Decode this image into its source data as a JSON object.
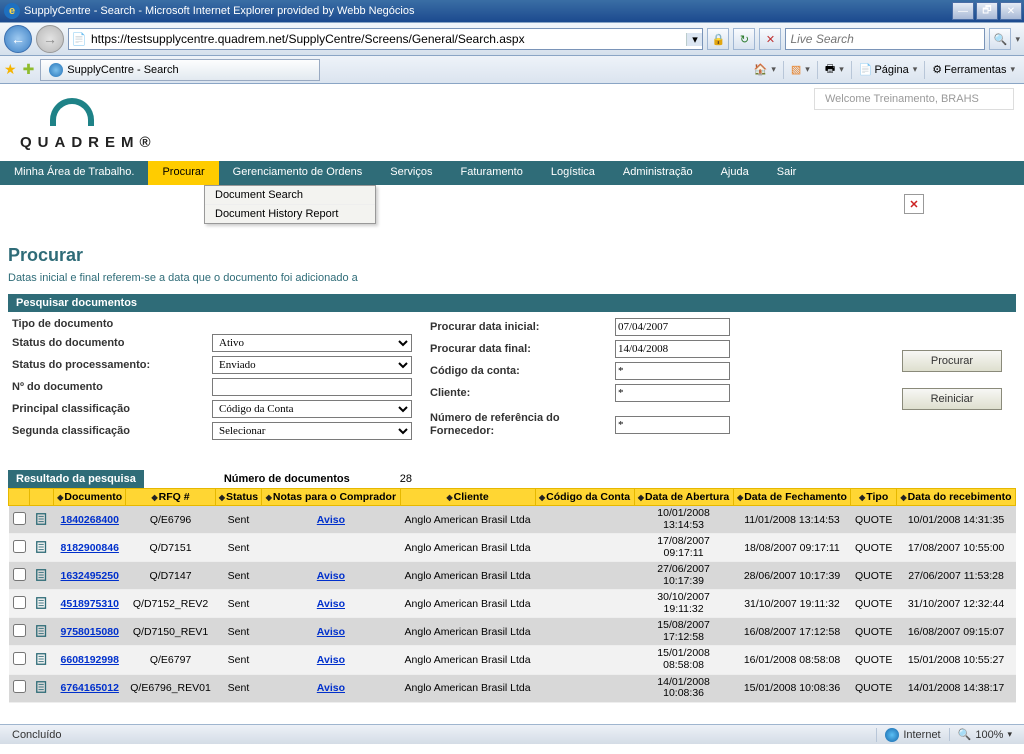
{
  "titlebar": {
    "text": "SupplyCentre - Search - Microsoft Internet Explorer provided by Webb Negócios"
  },
  "address": {
    "url": "https://testsupplycentre.quadrem.net/SupplyCentre/Screens/General/Search.aspx",
    "search_placeholder": "Live Search"
  },
  "tab": {
    "title": "SupplyCentre - Search"
  },
  "toolbar": {
    "pagina_label": "Página",
    "ferramentas_label": "Ferramentas"
  },
  "welcome": "Welcome  Treinamento, BRAHS",
  "logo_text": "QUADREM®",
  "menu": {
    "items": [
      "Minha Área de Trabalho.",
      "Procurar",
      "Gerenciamento de Ordens",
      "Serviços",
      "Faturamento",
      "Logística",
      "Administração",
      "Ajuda",
      "Sair"
    ],
    "active_index": 1,
    "submenu": [
      "Document Search",
      "Document History Report"
    ]
  },
  "page_title": "Procurar",
  "subtitle": "Datas inicial e final referem-se a data que o documento foi adicionado a",
  "panel_title": "Pesquisar documentos",
  "form": {
    "tipo_doc": "Tipo de documento",
    "status_doc": "Status do documento",
    "status_doc_val": "Ativo",
    "status_proc": "Status do processamento:",
    "status_proc_val": "Enviado",
    "no_doc": "Nº do documento",
    "no_doc_val": "",
    "princ_class": "Principal classificação",
    "princ_class_val": "Código da Conta",
    "seg_class": "Segunda classificação",
    "seg_class_val": "Selecionar",
    "data_inicial": "Procurar data inicial:",
    "data_inicial_val": "07/04/2007",
    "data_final": "Procurar data final:",
    "data_final_val": "14/04/2008",
    "cod_conta": "Código da conta:",
    "cod_conta_val": "*",
    "cliente": "Cliente:",
    "cliente_val": "*",
    "num_ref": "Número de referência do Fornecedor:",
    "num_ref_val": "*",
    "btn_procurar": "Procurar",
    "btn_reiniciar": "Reiniciar"
  },
  "results": {
    "title": "Resultado da pesquisa",
    "ndoc_label": "Número de documentos",
    "ndoc": "28",
    "headers": [
      "",
      "",
      "Documento",
      "RFQ #",
      "Status",
      "Notas para o Comprador",
      "Cliente",
      "Código da Conta",
      "Data de Abertura",
      "Data de Fechamento",
      "Tipo",
      "Data do recebimento"
    ],
    "rows": [
      {
        "doc": "1840268400",
        "rfq": "Q/E6796",
        "status": "Sent",
        "nota": "Aviso",
        "cliente": "Anglo American Brasil Ltda",
        "abertura": "10/01/2008 13:14:53",
        "fechamento": "11/01/2008 13:14:53",
        "tipo": "QUOTE",
        "receb": "10/01/2008 14:31:35"
      },
      {
        "doc": "8182900846",
        "rfq": "Q/D7151",
        "status": "Sent",
        "nota": "",
        "cliente": "Anglo American Brasil Ltda",
        "abertura": "17/08/2007 09:17:11",
        "fechamento": "18/08/2007 09:17:11",
        "tipo": "QUOTE",
        "receb": "17/08/2007 10:55:00"
      },
      {
        "doc": "1632495250",
        "rfq": "Q/D7147",
        "status": "Sent",
        "nota": "Aviso",
        "cliente": "Anglo American Brasil Ltda",
        "abertura": "27/06/2007 10:17:39",
        "fechamento": "28/06/2007 10:17:39",
        "tipo": "QUOTE",
        "receb": "27/06/2007 11:53:28"
      },
      {
        "doc": "4518975310",
        "rfq": "Q/D7152_REV2",
        "status": "Sent",
        "nota": "Aviso",
        "cliente": "Anglo American Brasil Ltda",
        "abertura": "30/10/2007 19:11:32",
        "fechamento": "31/10/2007 19:11:32",
        "tipo": "QUOTE",
        "receb": "31/10/2007 12:32:44"
      },
      {
        "doc": "9758015080",
        "rfq": "Q/D7150_REV1",
        "status": "Sent",
        "nota": "Aviso",
        "cliente": "Anglo American Brasil Ltda",
        "abertura": "15/08/2007 17:12:58",
        "fechamento": "16/08/2007 17:12:58",
        "tipo": "QUOTE",
        "receb": "16/08/2007 09:15:07"
      },
      {
        "doc": "6608192998",
        "rfq": "Q/E6797",
        "status": "Sent",
        "nota": "Aviso",
        "cliente": "Anglo American Brasil Ltda",
        "abertura": "15/01/2008 08:58:08",
        "fechamento": "16/01/2008 08:58:08",
        "tipo": "QUOTE",
        "receb": "15/01/2008 10:55:27"
      },
      {
        "doc": "6764165012",
        "rfq": "Q/E6796_REV01",
        "status": "Sent",
        "nota": "Aviso",
        "cliente": "Anglo American Brasil Ltda",
        "abertura": "14/01/2008 10:08:36",
        "fechamento": "15/01/2008 10:08:36",
        "tipo": "QUOTE",
        "receb": "14/01/2008 14:38:17"
      }
    ]
  },
  "status": {
    "concluido": "Concluído",
    "internet": "Internet",
    "zoom": "100%"
  }
}
